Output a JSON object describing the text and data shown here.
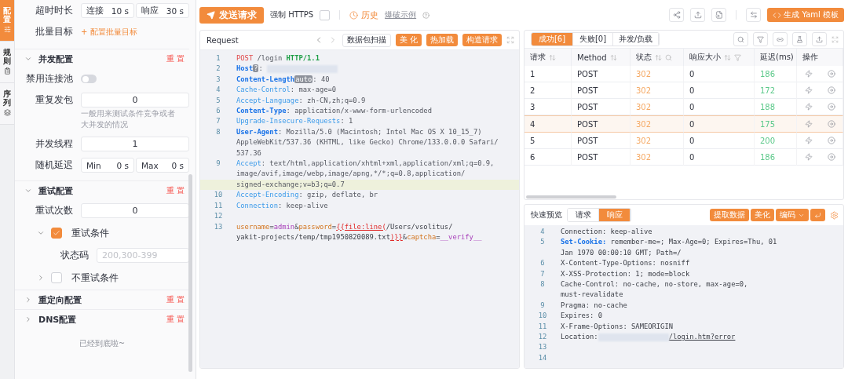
{
  "side_tabs": [
    {
      "label": "配置",
      "selected": true
    },
    {
      "label": "规则",
      "selected": false
    },
    {
      "label": "序列",
      "selected": false
    }
  ],
  "config": {
    "timeout": {
      "label": "超时时长",
      "fields": [
        {
          "prefix": "连接",
          "value": "10",
          "unit": "s"
        },
        {
          "prefix": "响应",
          "value": "30",
          "unit": "s"
        }
      ]
    },
    "batch": {
      "label": "批量目标",
      "link": "+ 配置批量目标"
    },
    "sections": [
      {
        "title": "并发配置",
        "expanded": true,
        "reset": "重 置",
        "items": [
          {
            "kind": "switch",
            "label": "禁用连接池",
            "on": false
          },
          {
            "kind": "input",
            "label": "重复发包",
            "value": "0",
            "hint": "一般用来测试条件竞争或者大并发的情况"
          },
          {
            "kind": "input",
            "label": "并发线程",
            "value": "1"
          },
          {
            "kind": "range",
            "label": "随机延迟",
            "fields": [
              {
                "prefix": "Min",
                "value": "0",
                "unit": "s"
              },
              {
                "prefix": "Max",
                "value": "0",
                "unit": "s"
              }
            ]
          }
        ]
      },
      {
        "title": "重试配置",
        "expanded": true,
        "reset": "重 置",
        "items": [
          {
            "kind": "input",
            "label": "重试次数",
            "value": "0"
          },
          {
            "kind": "condition",
            "label": "重试条件",
            "checked": true,
            "expanded": true,
            "fields": [
              {
                "label": "状态码",
                "placeholder": "200,300-399"
              }
            ]
          },
          {
            "kind": "condition",
            "label": "不重试条件",
            "checked": false,
            "expanded": false
          }
        ]
      },
      {
        "title": "重定向配置",
        "expanded": false,
        "reset": "重 置"
      },
      {
        "title": "DNS配置",
        "expanded": false,
        "reset": "重 置"
      }
    ],
    "footer": "已经到底啦~"
  },
  "toolbar": {
    "send": "发送请求",
    "https": {
      "label": "强制 HTTPS",
      "checked": false
    },
    "history": "历史",
    "example": "爆破示例",
    "generate": "生成 Yaml 模板"
  },
  "request": {
    "title": "Request",
    "buttons": [
      {
        "label": "数据包扫描",
        "kind": "outline"
      },
      {
        "label": "美 化",
        "kind": "primary"
      },
      {
        "label": "热加载",
        "kind": "primary"
      },
      {
        "label": "构造请求",
        "kind": "primary"
      }
    ],
    "lines": [
      {
        "no": "1",
        "active": false,
        "segments": [
          {
            "text": "POST",
            "kind": "method"
          },
          {
            "text": " /login ",
            "kind": "plain"
          },
          {
            "text": "HTTP/1.1",
            "kind": "proto"
          }
        ]
      },
      {
        "no": "2",
        "active": false,
        "segments": [
          {
            "text": "Host",
            "kind": "hb"
          },
          {
            "text": "?",
            "kind": "tag"
          },
          {
            "text": ": ",
            "kind": "plain"
          },
          {
            "kind": "redacted"
          }
        ]
      },
      {
        "no": "3",
        "active": false,
        "segments": [
          {
            "text": "Content-Length",
            "kind": "hb"
          },
          {
            "text": "auto",
            "kind": "tag"
          },
          {
            "text": ": 40",
            "kind": "plain"
          }
        ]
      },
      {
        "no": "4",
        "active": false,
        "segments": [
          {
            "text": "Cache-Control",
            "kind": "h"
          },
          {
            "text": ": max-age=0",
            "kind": "plain"
          }
        ]
      },
      {
        "no": "5",
        "active": false,
        "segments": [
          {
            "text": "Accept-Language",
            "kind": "h"
          },
          {
            "text": ": zh-CN,zh;q=0.9",
            "kind": "plain"
          }
        ]
      },
      {
        "no": "6",
        "active": false,
        "segments": [
          {
            "text": "Content-Type",
            "kind": "hb"
          },
          {
            "text": ": application/x-www-form-urlencoded",
            "kind": "plain"
          }
        ]
      },
      {
        "no": "7",
        "active": false,
        "segments": [
          {
            "text": "Upgrade-Insecure-Requests",
            "kind": "h"
          },
          {
            "text": ": 1",
            "kind": "plain"
          }
        ]
      },
      {
        "no": "8",
        "active": false,
        "segments": [
          {
            "text": "User-Agent",
            "kind": "hb"
          },
          {
            "text": ": Mozilla/5.0 (Macintosh; Intel Mac OS X 10_15_7)",
            "kind": "plain"
          },
          {
            "kind": "break"
          },
          {
            "text": "AppleWebKit/537.36 (KHTML, like Gecko) Chrome/133.0.0.0 Safari/",
            "kind": "plain"
          },
          {
            "kind": "break"
          },
          {
            "text": "537.36",
            "kind": "plain"
          }
        ]
      },
      {
        "no": "9",
        "active": true,
        "segments": [
          {
            "text": "Accept",
            "kind": "h"
          },
          {
            "text": ": text/html,application/xhtml+xml,application/xml;q=0.9,",
            "kind": "plain"
          },
          {
            "kind": "break"
          },
          {
            "text": "image/avif,image/webp,image/apng,*/*;q=0.8,application/",
            "kind": "plain"
          },
          {
            "kind": "break"
          },
          {
            "text": "signed-exchange;v=b3;q=0.7",
            "kind": "plain"
          }
        ]
      },
      {
        "no": "10",
        "active": false,
        "segments": [
          {
            "text": "Accept-Encoding",
            "kind": "h"
          },
          {
            "text": ": gzip, deflate, br",
            "kind": "plain"
          }
        ]
      },
      {
        "no": "11",
        "active": false,
        "segments": [
          {
            "text": "Connection",
            "kind": "h"
          },
          {
            "text": ": keep-alive",
            "kind": "plain"
          }
        ]
      },
      {
        "no": "12",
        "active": false
      },
      {
        "no": "13",
        "active": false,
        "segments": [
          {
            "text": "username",
            "kind": "pk"
          },
          {
            "text": "=",
            "kind": "plain"
          },
          {
            "text": "admin",
            "kind": "pv"
          },
          {
            "text": "&",
            "kind": "plain"
          },
          {
            "text": "password",
            "kind": "pk"
          },
          {
            "text": "=",
            "kind": "plain"
          },
          {
            "text": "{{file:line(",
            "kind": "fuzz"
          },
          {
            "text": "/Users/vsolitus/",
            "kind": "dark"
          },
          {
            "kind": "break"
          },
          {
            "text": "yakit-projects/temp/tmp1950820089.txt",
            "kind": "dark"
          },
          {
            "text": ")}}",
            "kind": "fuzz"
          },
          {
            "text": "&",
            "kind": "plain"
          },
          {
            "text": "captcha",
            "kind": "pk"
          },
          {
            "text": "=",
            "kind": "plain"
          },
          {
            "text": "__verify__",
            "kind": "pv"
          }
        ]
      }
    ]
  },
  "results": {
    "tabs": [
      {
        "label": "成功[6]",
        "selected": true
      },
      {
        "label": "失败[0]",
        "selected": false
      },
      {
        "label": "并发/负载",
        "selected": false
      }
    ],
    "columns": [
      {
        "label": "请求",
        "sort": true,
        "search": false,
        "filter": false
      },
      {
        "label": "Method",
        "sort": true,
        "search": false,
        "filter": false
      },
      {
        "label": "状态",
        "sort": true,
        "search": true,
        "filter": false
      },
      {
        "label": "响应大小",
        "sort": true,
        "search": false,
        "filter": true
      },
      {
        "label": "延迟(ms)",
        "sort": false,
        "search": false,
        "filter": false
      },
      {
        "label": "操作",
        "sort": false,
        "search": false,
        "filter": false
      }
    ],
    "rows": [
      {
        "cells": [
          "1",
          "POST",
          "302",
          "0",
          "186"
        ],
        "selected": false
      },
      {
        "cells": [
          "2",
          "POST",
          "302",
          "0",
          "172"
        ],
        "selected": false
      },
      {
        "cells": [
          "3",
          "POST",
          "302",
          "0",
          "188"
        ],
        "selected": false
      },
      {
        "cells": [
          "4",
          "POST",
          "302",
          "0",
          "175"
        ],
        "selected": true
      },
      {
        "cells": [
          "5",
          "POST",
          "302",
          "0",
          "200"
        ],
        "selected": false
      },
      {
        "cells": [
          "6",
          "POST",
          "302",
          "0",
          "186"
        ],
        "selected": false
      }
    ]
  },
  "preview": {
    "title": "快速预览",
    "tabs": [
      {
        "label": "请求",
        "selected": false
      },
      {
        "label": "响应",
        "selected": true
      }
    ],
    "buttons": [
      {
        "label": "提取数据",
        "kind": "plain"
      },
      {
        "label": "美化",
        "kind": "plain"
      },
      {
        "label": "编码",
        "kind": "dropdown"
      }
    ],
    "lines": [
      {
        "no": "4",
        "segments": [
          {
            "text": "Connection: keep-alive",
            "kind": "dark"
          }
        ]
      },
      {
        "no": "5",
        "segments": [
          {
            "text": "Set-Cookie:",
            "kind": "hb"
          },
          {
            "text": " remember-me=; Max-Age=0; Expires=Thu, 01",
            "kind": "dark"
          },
          {
            "kind": "break"
          },
          {
            "text": "Jan 1970 00:00:10 GMT; Path=/",
            "kind": "dark"
          }
        ]
      },
      {
        "no": "6",
        "segments": [
          {
            "text": "X-Content-Type-Options: nosniff",
            "kind": "dark"
          }
        ]
      },
      {
        "no": "7",
        "segments": [
          {
            "text": "X-XSS-Protection: 1; mode=block",
            "kind": "dark"
          }
        ]
      },
      {
        "no": "8",
        "segments": [
          {
            "text": "Cache-Control: no-cache, no-store, max-age=0,",
            "kind": "dark"
          },
          {
            "kind": "break"
          },
          {
            "text": "must-revalidate",
            "kind": "dark"
          }
        ]
      },
      {
        "no": "9",
        "segments": [
          {
            "text": "Pragma: no-cache",
            "kind": "dark"
          }
        ]
      },
      {
        "no": "10",
        "segments": [
          {
            "text": "Expires: 0",
            "kind": "dark"
          }
        ]
      },
      {
        "no": "11",
        "segments": [
          {
            "text": "X-Frame-Options: SAMEORIGIN",
            "kind": "dark"
          }
        ]
      },
      {
        "no": "12",
        "segments": [
          {
            "text": "Location:",
            "kind": "dark"
          },
          {
            "kind": "redacted"
          },
          {
            "text": "/login.htm?error",
            "kind": "link"
          }
        ]
      },
      {
        "no": "13"
      },
      {
        "no": "14"
      }
    ]
  }
}
